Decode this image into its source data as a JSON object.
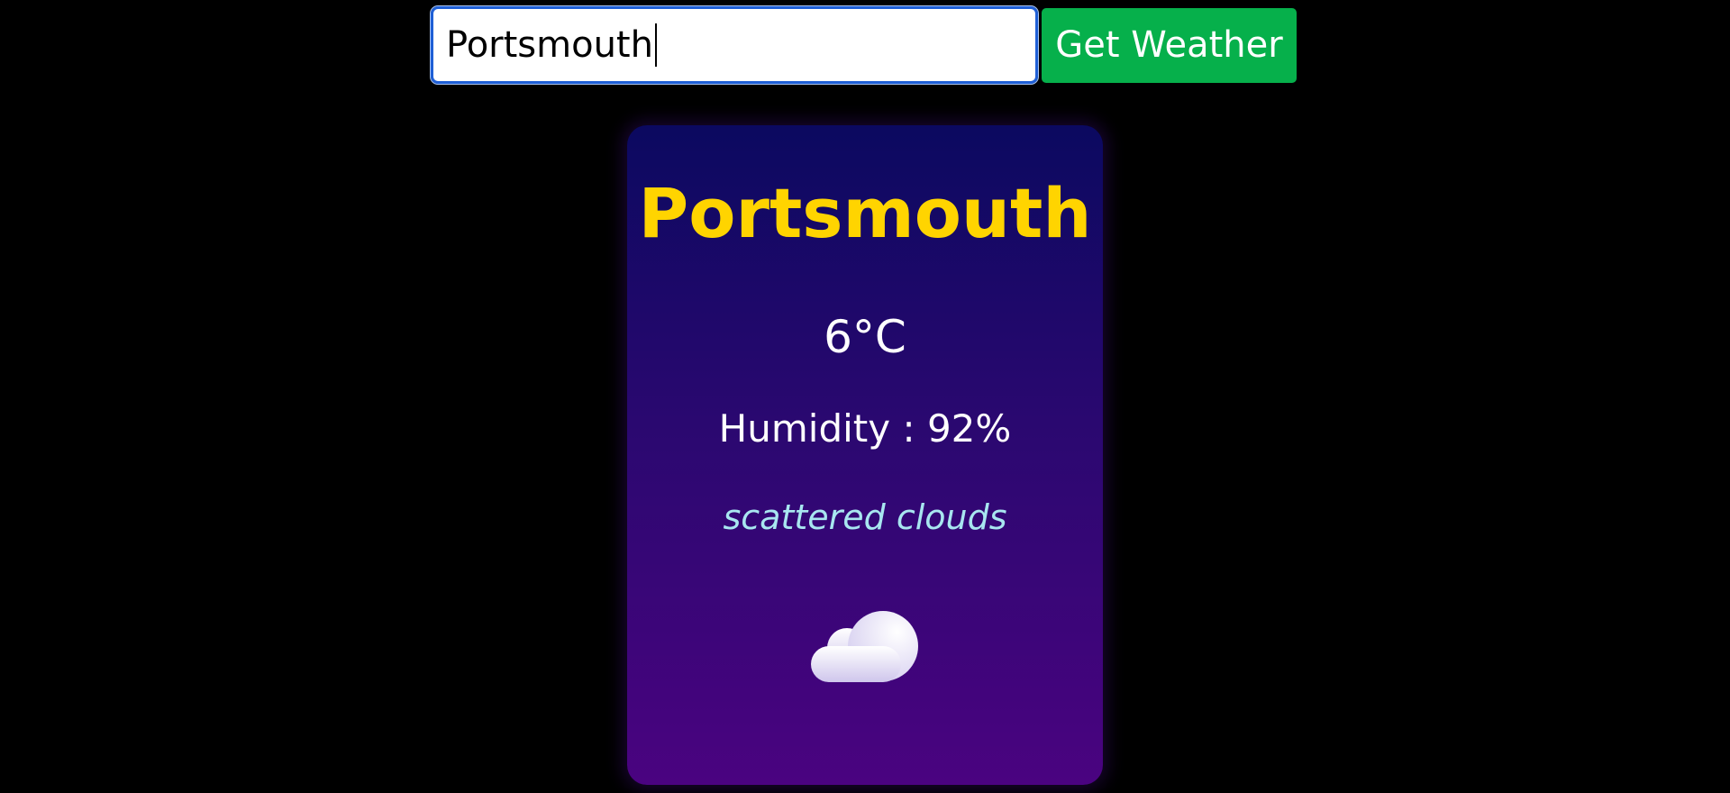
{
  "search": {
    "value": "Portsmouth",
    "button_label": "Get Weather"
  },
  "weather": {
    "city": "Portsmouth",
    "temperature": "6°C",
    "humidity": "Humidity : 92%",
    "description": "scattered clouds",
    "icon": "cloud-icon"
  },
  "colors": {
    "background": "#000000",
    "button": "#06b04b",
    "city_name": "#ffd400",
    "description": "#a8e6f0",
    "card_gradient_top": "#0b0960",
    "card_gradient_bottom": "#4a0380"
  }
}
